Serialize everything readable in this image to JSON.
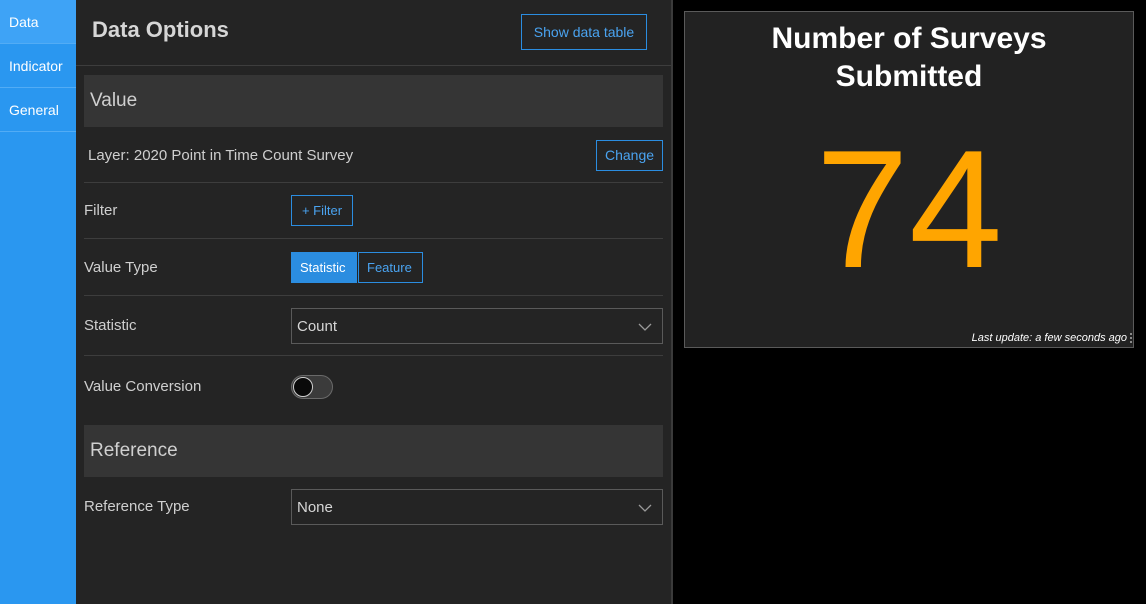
{
  "tabs": [
    {
      "label": "Data",
      "active": true
    },
    {
      "label": "Indicator",
      "active": false
    },
    {
      "label": "General",
      "active": false
    }
  ],
  "panel": {
    "title": "Data Options",
    "show_table_label": "Show data table"
  },
  "value_section": {
    "heading": "Value",
    "layer_text": "Layer: 2020 Point in Time Count Survey",
    "change_label": "Change",
    "filter_label": "Filter",
    "filter_button": "+ Filter",
    "value_type_label": "Value Type",
    "value_type_options": [
      "Statistic",
      "Feature"
    ],
    "value_type_selected": "Statistic",
    "statistic_label": "Statistic",
    "statistic_value": "Count",
    "value_conversion_label": "Value Conversion",
    "value_conversion_on": false
  },
  "reference_section": {
    "heading": "Reference",
    "reference_type_label": "Reference Type",
    "reference_type_value": "None"
  },
  "indicator": {
    "title_line1": "Number of Surveys",
    "title_line2": "Submitted",
    "value": "74",
    "last_update": "Last update: a few seconds ago",
    "value_color": "#ffa500"
  },
  "colors": {
    "accent": "#2b8de0",
    "tab_bg": "#2a97f0",
    "panel_bg": "#242424"
  },
  "icons": {
    "select_chevron": "chevron-down-icon",
    "toggle": "toggle-switch"
  }
}
